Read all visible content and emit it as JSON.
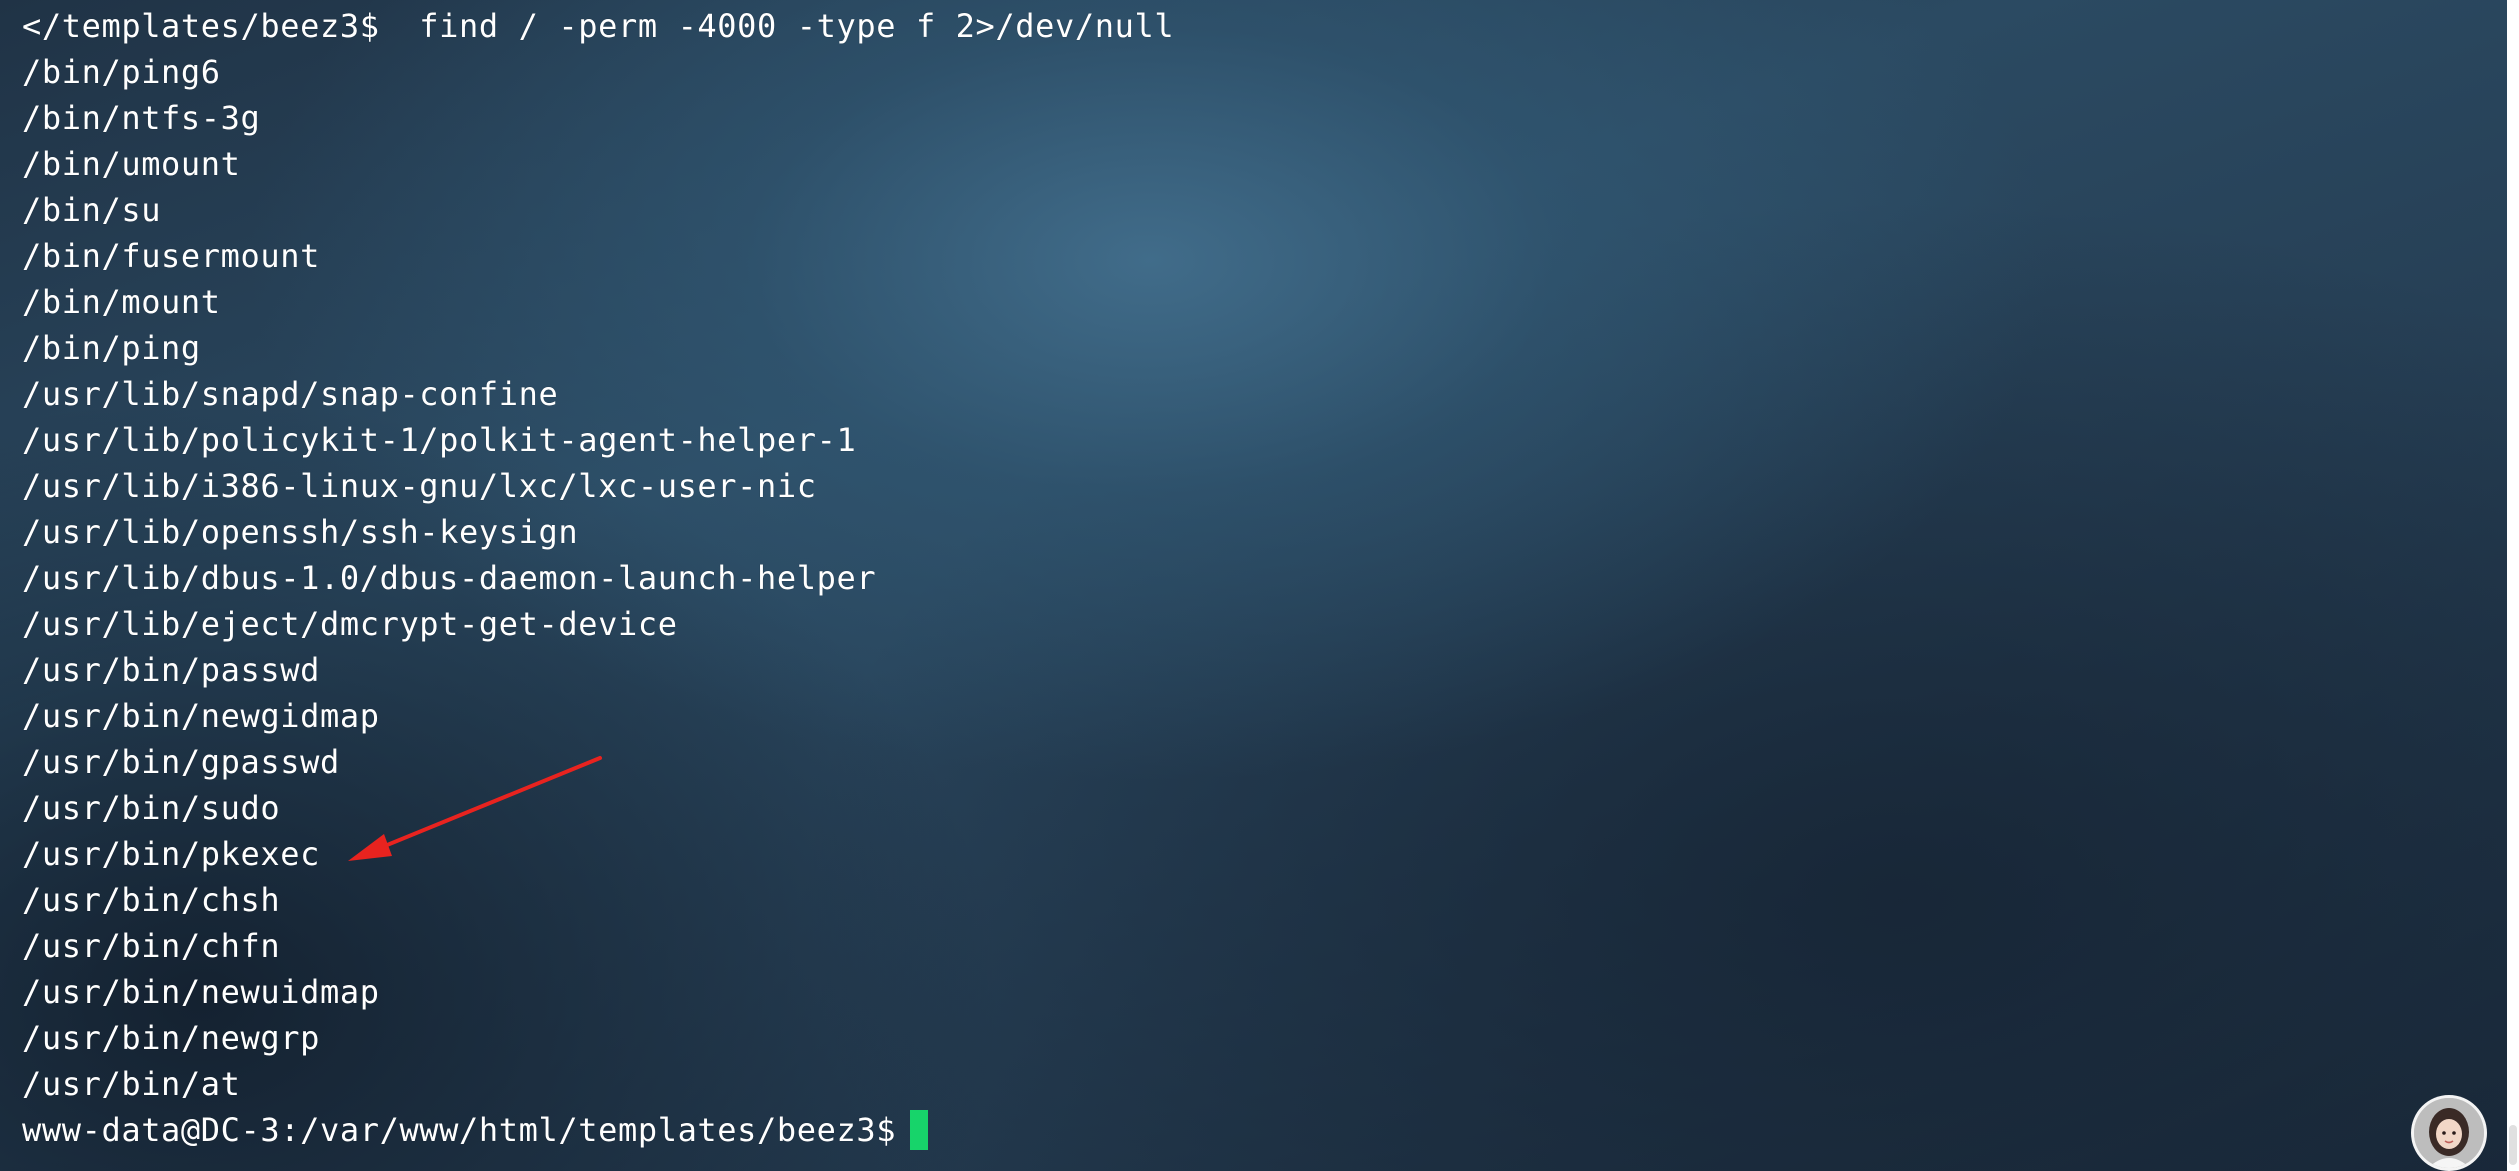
{
  "terminal": {
    "command_line": "</templates/beez3$  find / -perm -4000 -type f 2>/dev/null",
    "output": [
      "/bin/ping6",
      "/bin/ntfs-3g",
      "/bin/umount",
      "/bin/su",
      "/bin/fusermount",
      "/bin/mount",
      "/bin/ping",
      "/usr/lib/snapd/snap-confine",
      "/usr/lib/policykit-1/polkit-agent-helper-1",
      "/usr/lib/i386-linux-gnu/lxc/lxc-user-nic",
      "/usr/lib/openssh/ssh-keysign",
      "/usr/lib/dbus-1.0/dbus-daemon-launch-helper",
      "/usr/lib/eject/dmcrypt-get-device",
      "/usr/bin/passwd",
      "/usr/bin/newgidmap",
      "/usr/bin/gpasswd",
      "/usr/bin/sudo",
      "/usr/bin/pkexec",
      "/usr/bin/chsh",
      "/usr/bin/chfn",
      "/usr/bin/newuidmap",
      "/usr/bin/newgrp",
      "/usr/bin/at"
    ],
    "prompt": "www-data@DC-3:/var/www/html/templates/beez3$"
  },
  "colors": {
    "text": "#ffffff",
    "cursor": "#17d46a",
    "annotation_arrow": "#e8231f",
    "background": "#2b4a62"
  },
  "annotation": {
    "icon": "arrow-icon",
    "target": "/usr/bin/pkexec"
  },
  "icons": {
    "avatar": "avatar-icon"
  }
}
